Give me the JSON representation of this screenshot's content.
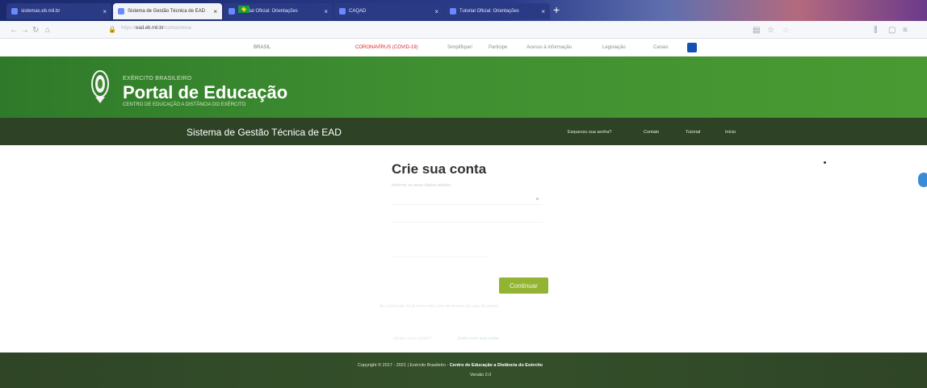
{
  "browser": {
    "tabs": [
      {
        "label": "sistemas.eb.mil.br",
        "active": false
      },
      {
        "label": "Sistema de Gestão Técnica de EAD",
        "active": true
      },
      {
        "label": "Tutorial Oficial: Orientações",
        "active": false
      },
      {
        "label": "CAQAD",
        "active": false
      },
      {
        "label": "Tutorial Oficial: Orientações",
        "active": false
      }
    ],
    "url_prefix": "https://",
    "url_domain": "ead.eb.mil.br",
    "url_path": "/contas/nova"
  },
  "gov": {
    "brasil": "BRASIL",
    "links": [
      {
        "label": "CORONAVÍRUS (COVID-19)",
        "highlight": true
      },
      {
        "label": "Simplifique!",
        "highlight": false
      },
      {
        "label": "Participe",
        "highlight": false
      },
      {
        "label": "Acesso à informação",
        "highlight": false
      },
      {
        "label": "Legislação",
        "highlight": false
      },
      {
        "label": "Canais",
        "highlight": false
      }
    ]
  },
  "header": {
    "org": "EXÉRCITO BRASILEIRO",
    "title": "Portal de Educação",
    "subtitle": "CENTRO DE EDUCAÇÃO A DISTÂNCIA DO EXÉRCITO"
  },
  "subnav": {
    "system_title": "Sistema de Gestão Técnica de EAD",
    "links": [
      "Esqueceu sua senha?",
      "Contato",
      "Tutorial",
      "Início"
    ]
  },
  "form": {
    "title": "Crie sua conta",
    "hint": "Informe os seus dados abaixo",
    "continue_label": "Continuar",
    "note": "Ao continuar você concorda com os termos de uso do portal",
    "login_prompt": "Já tem uma conta?",
    "login_link": "Entre com sua conta"
  },
  "footer": {
    "copyright_prefix": "Copyright © 2017 - 2021 | Exército Brasileiro -",
    "copyright_org": "Centro de Educação a Distância do Exército",
    "version": "Versão 2.0"
  },
  "colors": {
    "header_green": "#3f8f31",
    "subnav_green": "#2e4226",
    "button_green": "#93b332",
    "gov_red": "#d8262e"
  }
}
